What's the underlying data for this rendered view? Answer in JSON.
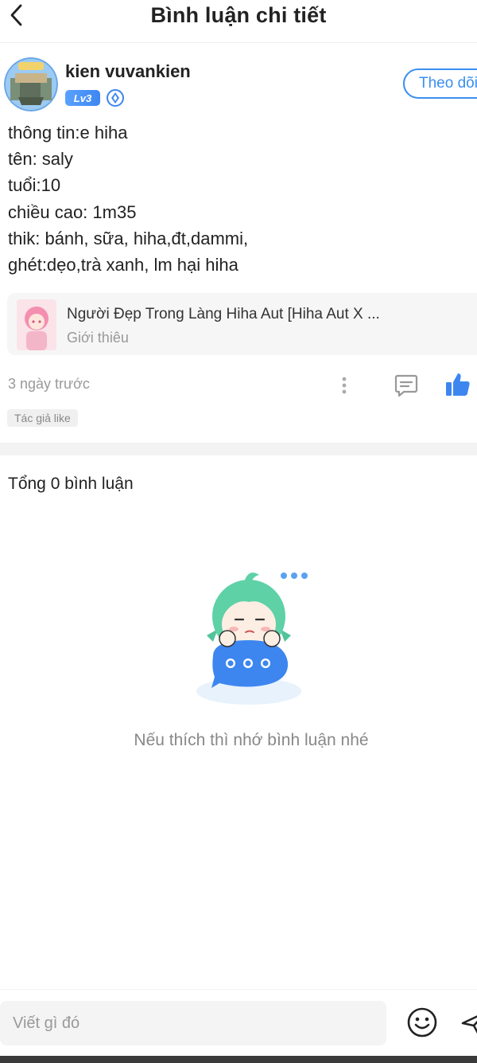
{
  "header": {
    "title": "Bình luận chi tiết"
  },
  "author": {
    "name": "kien vuvankien",
    "level": "Lv3",
    "follow_label": "Theo dõi"
  },
  "content": {
    "lines": [
      "thông tin:e hiha",
      "tên: saly",
      "tuổi:10",
      "chiều cao: 1m35",
      "thik: bánh, sữa, hiha,đt,dammi,",
      "ghét:dẹo,trà xanh, lm hại hiha"
    ]
  },
  "story": {
    "title": "Người Đẹp Trong Làng Hiha Aut [Hiha Aut X ...",
    "subtitle": "Giới thiêu"
  },
  "meta": {
    "time": "3 ngày trước",
    "author_like_tag": "Tác giả like"
  },
  "comments": {
    "total_label": "Tổng 0 bình luận",
    "empty_text": "Nếu thích thì nhớ bình luận nhé"
  },
  "input": {
    "placeholder": "Viết gì đó"
  },
  "colors": {
    "accent": "#3a8ff0",
    "like": "#3d86f0",
    "muted": "#999999"
  },
  "icons": {
    "back": "chevron-left-icon",
    "more": "more-vertical-icon",
    "comment": "comment-icon",
    "like": "thumbs-up-icon",
    "emoji": "smiley-icon",
    "send": "send-icon"
  }
}
